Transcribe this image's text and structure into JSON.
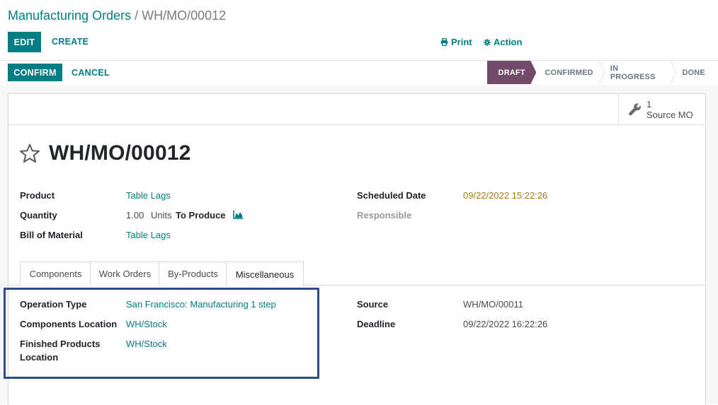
{
  "breadcrumb": {
    "parent": "Manufacturing Orders",
    "separator": "/",
    "current": "WH/MO/00012"
  },
  "toolbar": {
    "edit": "EDIT",
    "create": "CREATE",
    "print": "Print",
    "action": "Action"
  },
  "statusbar": {
    "confirm": "CONFIRM",
    "cancel": "CANCEL",
    "stages": [
      "DRAFT",
      "CONFIRMED",
      "IN PROGRESS",
      "DONE"
    ],
    "active_stage": "DRAFT"
  },
  "smart_button": {
    "count": "1",
    "label": "Source MO"
  },
  "record": {
    "name": "WH/MO/00012"
  },
  "fields": {
    "product_label": "Product",
    "product_value": "Table Lags",
    "quantity_label": "Quantity",
    "quantity_value": "1.00",
    "quantity_unit": "Units",
    "quantity_suffix": "To Produce",
    "bom_label": "Bill of Material",
    "bom_value": "Table Lags",
    "scheduled_label": "Scheduled Date",
    "scheduled_value": "09/22/2022 15:22:26",
    "responsible_label": "Responsible"
  },
  "tabs": [
    "Components",
    "Work Orders",
    "By-Products",
    "Miscellaneous"
  ],
  "active_tab": "Miscellaneous",
  "misc": {
    "operation_type_label": "Operation Type",
    "operation_type_value": "San Francisco: Manufacturing 1 step",
    "components_location_label": "Components Location",
    "components_location_value": "WH/Stock",
    "finished_location_label_1": "Finished Products",
    "finished_location_label_2": "Location",
    "finished_location_value": "WH/Stock",
    "source_label": "Source",
    "source_value": "WH/MO/00011",
    "deadline_label": "Deadline",
    "deadline_value": "09/22/2022 16:22:26"
  },
  "colors": {
    "primary": "#017e84",
    "draft_stage": "#714b67",
    "warning_date": "#a67b1d",
    "highlight_box": "#2d4d86"
  }
}
